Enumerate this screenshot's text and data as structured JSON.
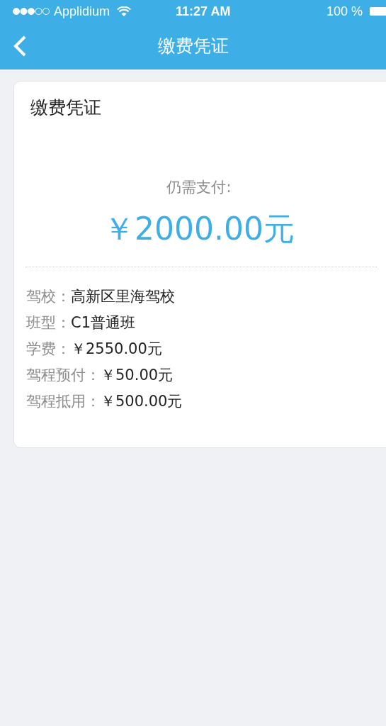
{
  "status_bar": {
    "carrier": "Applidium",
    "time": "11:27 AM",
    "battery": "100 %"
  },
  "nav": {
    "title": "缴费凭证"
  },
  "card": {
    "title": "缴费凭证",
    "amount_label": "仍需支付:",
    "amount": "￥2000.00元",
    "details": [
      {
        "label": "驾校：",
        "value": "高新区里海驾校"
      },
      {
        "label": "班型：",
        "value": "C1普通班"
      },
      {
        "label": "学费：",
        "value": "￥2550.00元"
      },
      {
        "label": "驾程预付：",
        "value": "￥50.00元"
      },
      {
        "label": "驾程抵用：",
        "value": "￥500.00元"
      }
    ]
  }
}
